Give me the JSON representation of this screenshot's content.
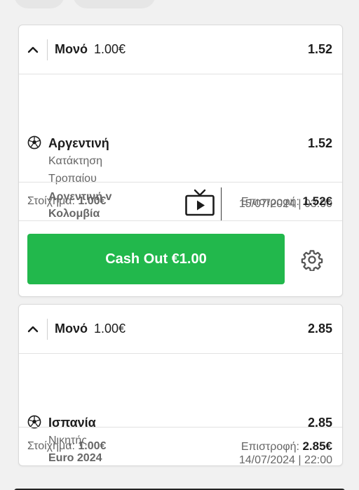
{
  "bets": [
    {
      "type": "Μονό",
      "stake": "1.00€",
      "odds": "1.52",
      "selection": {
        "name": "Αργεντινή",
        "odds": "1.52",
        "market_line1": "Κατάκτηση",
        "market_line2": "Τροπαίου",
        "event_line1": "Αργεντινή v",
        "event_line2": "Κολομβία",
        "datetime": "15/07/2024 | 03:00",
        "icon": "soccer-ball-icon",
        "tv_icon": "live-tv-icon"
      },
      "stake_label": "Στοίχημα:",
      "stake_value": "1.00€",
      "return_label": "Επιστροφή:",
      "return_value": "1.52€",
      "cashout_label": "Cash Out €1.00"
    },
    {
      "type": "Μονό",
      "stake": "1.00€",
      "odds": "2.85",
      "selection": {
        "name": "Ισπανία",
        "odds": "2.85",
        "market": "Νικητής",
        "event": "Euro 2024",
        "datetime": "14/07/2024 | 22:00",
        "icon": "soccer-ball-icon"
      },
      "stake_label": "Στοίχημα:",
      "stake_value": "1.00€",
      "return_label": "Επιστροφή:",
      "return_value": "2.85€"
    }
  ],
  "colors": {
    "cashout_green": "#22b84c",
    "page_bg": "#f1f1f1",
    "muted_text": "#666666"
  }
}
